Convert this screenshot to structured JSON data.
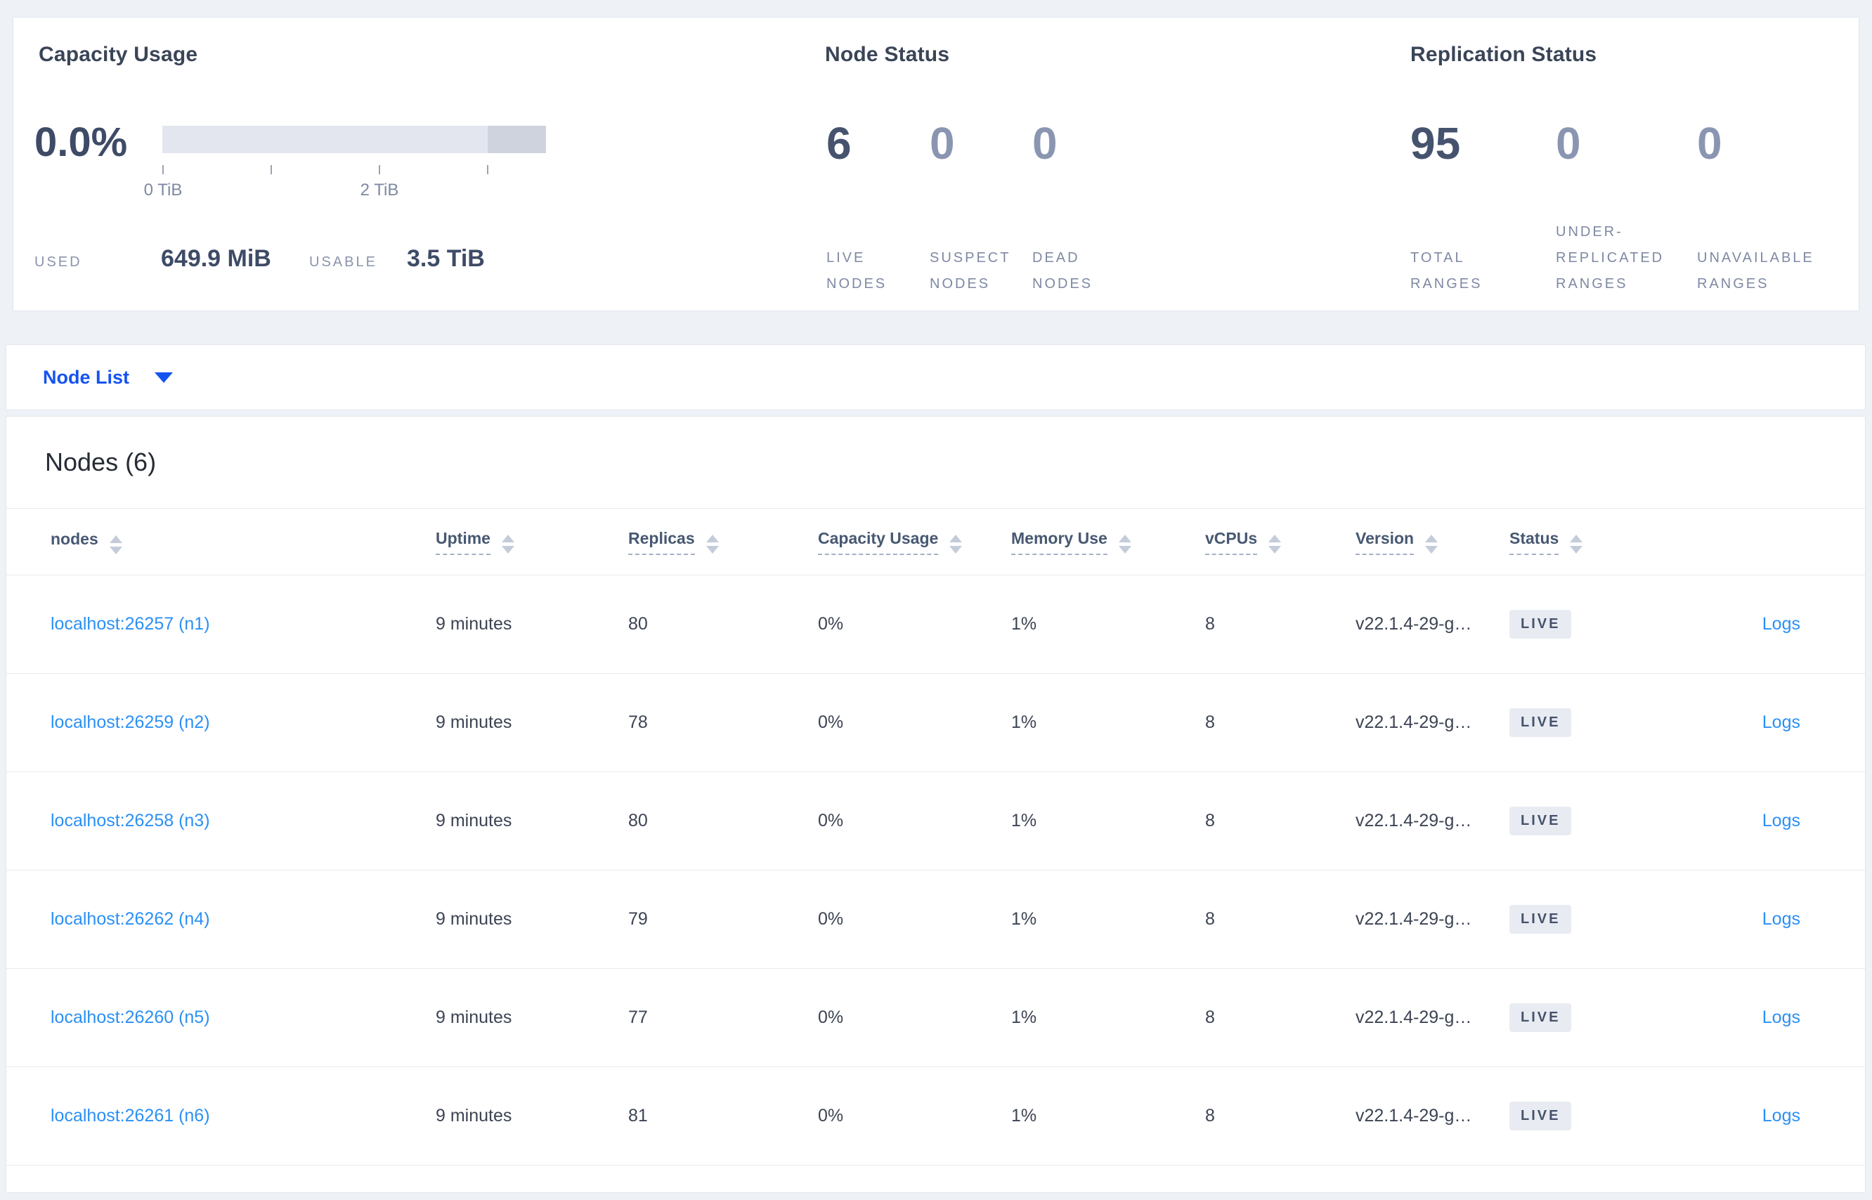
{
  "summary": {
    "capacity": {
      "title": "Capacity Usage",
      "percent": "0.0%",
      "tick_label_0": "0 TiB",
      "tick_label_2": "2 TiB",
      "used_label": "USED",
      "used_value": "649.9 MiB",
      "usable_label": "USABLE",
      "usable_value": "3.5 TiB"
    },
    "node_status": {
      "title": "Node Status",
      "stats": [
        {
          "value": "6",
          "label": "LIVE NODES"
        },
        {
          "value": "0",
          "label": "SUSPECT NODES"
        },
        {
          "value": "0",
          "label": "DEAD NODES"
        }
      ]
    },
    "replication": {
      "title": "Replication Status",
      "stats": [
        {
          "value": "95",
          "label": "TOTAL RANGES"
        },
        {
          "value": "0",
          "label": "UNDER-REPLICATED RANGES"
        },
        {
          "value": "0",
          "label": "UNAVAILABLE RANGES"
        }
      ]
    }
  },
  "node_list": {
    "label": "Node List"
  },
  "table": {
    "title": "Nodes (6)",
    "headers": [
      {
        "label": "nodes"
      },
      {
        "label": "Uptime"
      },
      {
        "label": "Replicas"
      },
      {
        "label": "Capacity Usage"
      },
      {
        "label": "Memory Use"
      },
      {
        "label": "vCPUs"
      },
      {
        "label": "Version"
      },
      {
        "label": "Status"
      }
    ],
    "rows": [
      {
        "address": "localhost:26257 (n1)",
        "uptime": "9 minutes",
        "replicas": "80",
        "capacity": "0%",
        "memory": "1%",
        "vcpus": "8",
        "version": "v22.1.4-29-g…",
        "status": "LIVE",
        "logs": "Logs"
      },
      {
        "address": "localhost:26259 (n2)",
        "uptime": "9 minutes",
        "replicas": "78",
        "capacity": "0%",
        "memory": "1%",
        "vcpus": "8",
        "version": "v22.1.4-29-g…",
        "status": "LIVE",
        "logs": "Logs"
      },
      {
        "address": "localhost:26258 (n3)",
        "uptime": "9 minutes",
        "replicas": "80",
        "capacity": "0%",
        "memory": "1%",
        "vcpus": "8",
        "version": "v22.1.4-29-g…",
        "status": "LIVE",
        "logs": "Logs"
      },
      {
        "address": "localhost:26262 (n4)",
        "uptime": "9 minutes",
        "replicas": "79",
        "capacity": "0%",
        "memory": "1%",
        "vcpus": "8",
        "version": "v22.1.4-29-g…",
        "status": "LIVE",
        "logs": "Logs"
      },
      {
        "address": "localhost:26260 (n5)",
        "uptime": "9 minutes",
        "replicas": "77",
        "capacity": "0%",
        "memory": "1%",
        "vcpus": "8",
        "version": "v22.1.4-29-g…",
        "status": "LIVE",
        "logs": "Logs"
      },
      {
        "address": "localhost:26261 (n6)",
        "uptime": "9 minutes",
        "replicas": "81",
        "capacity": "0%",
        "memory": "1%",
        "vcpus": "8",
        "version": "v22.1.4-29-g…",
        "status": "LIVE",
        "logs": "Logs"
      }
    ]
  },
  "colors": {
    "page_background": "#eef1f6",
    "card_background": "#ffffff",
    "link_blue": "#2b90f5",
    "dropdown_blue": "#1553f1",
    "badge_background": "#e8ecf2",
    "bar_track": "#e3e6ee",
    "bar_tail": "#ced3de",
    "stat_number_dark": "#46536e",
    "stat_number_muted": "#8a96b1"
  }
}
